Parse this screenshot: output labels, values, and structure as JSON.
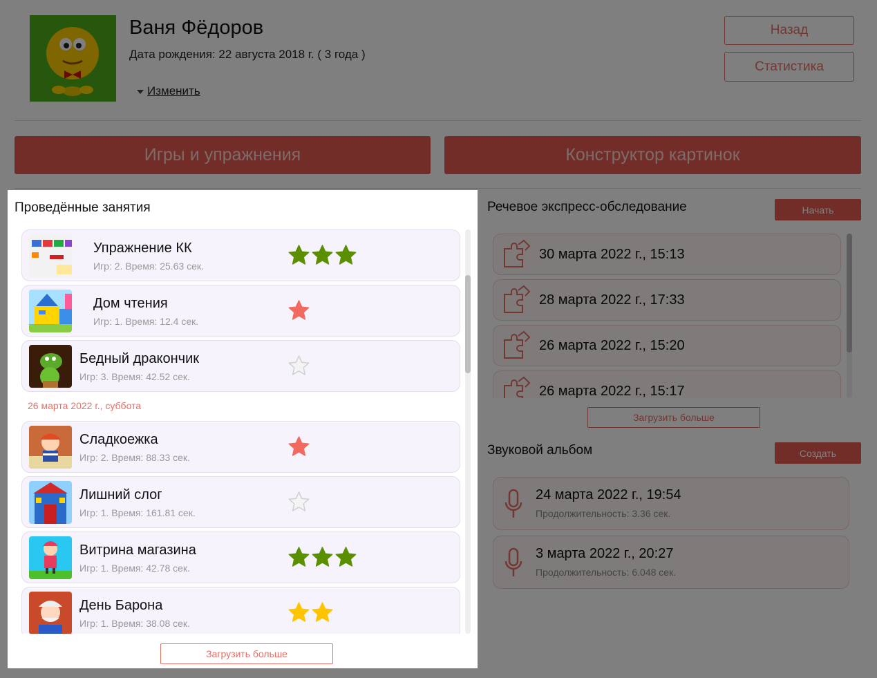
{
  "header": {
    "name": "Ваня Фёдоров",
    "birth": "Дата рождения: 22 августа 2018 г. ( 3 года )",
    "change": "Изменить",
    "back": "Назад",
    "stats": "Статистика"
  },
  "tabs": {
    "games": "Игры и упражнения",
    "constructor": "Конструктор картинок"
  },
  "activities": {
    "title": "Проведённые занятия",
    "more": "Загрузить больше",
    "date_separator": "26 марта 2022 г., суббота",
    "items": [
      {
        "name": "Упражнение КК",
        "stat": "Игр: 2. Время: 25.63 сек.",
        "stars": 3,
        "star_color": "#5a8f00"
      },
      {
        "name": "Дом чтения",
        "stat": "Игр: 1. Время: 12.4 сек.",
        "stars": 1,
        "star_color": "#f26a5f"
      },
      {
        "name": "Бедный дракончик",
        "stat": "Игр: 3. Время: 42.52 сек.",
        "stars": 0,
        "star_color": "#e0e0e0"
      },
      {
        "name": "Сладкоежка",
        "stat": "Игр: 2. Время: 88.33 сек.",
        "stars": 1,
        "star_color": "#f26a5f"
      },
      {
        "name": "Лишний слог",
        "stat": "Игр: 1. Время: 161.81 сек.",
        "stars": 0,
        "star_color": "#e0e0e0"
      },
      {
        "name": "Витрина магазина",
        "stat": "Игр: 1. Время: 42.78 сек.",
        "stars": 3,
        "star_color": "#5a8f00"
      },
      {
        "name": "День Барона",
        "stat": "Игр: 1. Время: 38.08 сек.",
        "stars": 2,
        "star_color": "#ffc400"
      }
    ]
  },
  "survey": {
    "title": "Речевое экспресс-обследование",
    "start": "Начать",
    "more": "Загрузить больше",
    "items": [
      "30 марта 2022 г., 15:13",
      "28 марта 2022 г., 17:33",
      "26 марта 2022 г., 15:20",
      "26 марта 2022 г., 15:17"
    ]
  },
  "album": {
    "title": "Звуковой альбом",
    "create": "Создать",
    "items": [
      {
        "date": "24 марта 2022 г., 19:54",
        "duration": "Продолжительность: 3.36 сек."
      },
      {
        "date": "3 марта 2022 г., 20:27",
        "duration": "Продолжительность: 6.048 сек."
      }
    ]
  },
  "colors": {
    "accent": "#e55a50",
    "star_green": "#5a8f00",
    "star_red": "#f26a5f",
    "star_yellow": "#ffc400",
    "star_empty": "#e0e0e0"
  }
}
